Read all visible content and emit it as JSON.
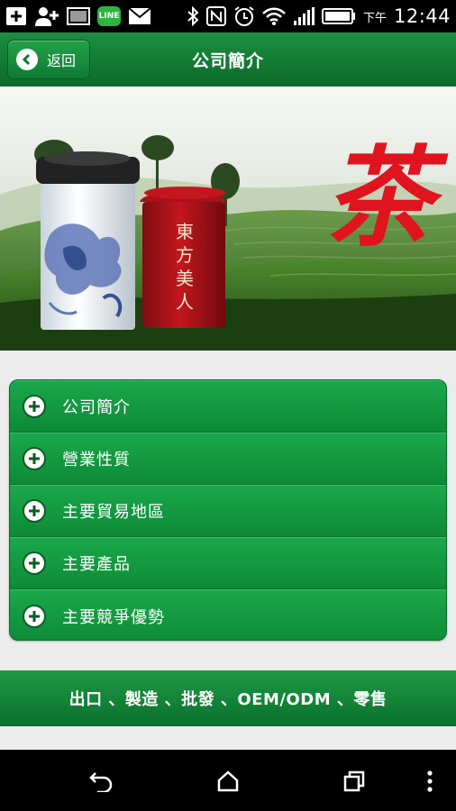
{
  "status_bar": {
    "line_badge": "LINE",
    "ampm": "下午",
    "time": "12:44",
    "icons": [
      "add-box-icon",
      "add-contact-icon",
      "photo-icon",
      "line-icon",
      "mail-icon",
      "bluetooth-icon",
      "nfc-icon",
      "alarm-icon",
      "wifi-icon",
      "signal-icon",
      "battery-icon"
    ]
  },
  "header": {
    "back_label": "返回",
    "title": "公司簡介"
  },
  "banner": {
    "calligraphy": "茶",
    "red_can_text": [
      "東",
      "方",
      "美",
      "人"
    ]
  },
  "menu": {
    "items": [
      {
        "label": "公司簡介"
      },
      {
        "label": "營業性質"
      },
      {
        "label": "主要貿易地區"
      },
      {
        "label": "主要產品"
      },
      {
        "label": "主要競爭優勢"
      }
    ]
  },
  "footer": {
    "text": "出口 、製造 、批發 、OEM/ODM 、零售"
  },
  "colors": {
    "header_green": "#118a3a",
    "menu_green": "#149a43",
    "calligraphy_red": "#e0141e"
  }
}
